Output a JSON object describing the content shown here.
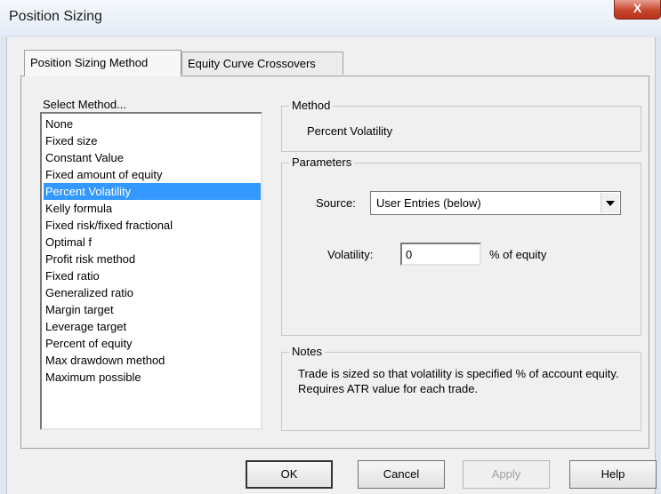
{
  "window": {
    "title": "Position Sizing",
    "close_label": "X"
  },
  "tabs": [
    {
      "label": "Position Sizing Method",
      "active": true
    },
    {
      "label": "Equity Curve Crossovers",
      "active": false
    }
  ],
  "method_list": {
    "label": "Select Method...",
    "items": [
      "None",
      "Fixed size",
      "Constant Value",
      "Fixed amount of equity",
      "Percent Volatility",
      "Kelly formula",
      "Fixed risk/fixed fractional",
      "Optimal f",
      "Profit risk method",
      "Fixed ratio",
      "Generalized ratio",
      "Margin target",
      "Leverage target",
      "Percent of equity",
      "Max drawdown method",
      "Maximum possible"
    ],
    "selected": "Percent Volatility"
  },
  "method_group": {
    "title": "Method",
    "value": "Percent Volatility"
  },
  "parameters": {
    "title": "Parameters",
    "source_label": "Source:",
    "source_value": "User Entries (below)",
    "volatility_label": "Volatility:",
    "volatility_value": "0",
    "volatility_unit": "% of equity"
  },
  "notes": {
    "title": "Notes",
    "text": "Trade is sized so that volatility is specified % of account equity. Requires ATR value for each trade."
  },
  "buttons": {
    "ok": "OK",
    "cancel": "Cancel",
    "apply": "Apply",
    "help": "Help"
  },
  "colors": {
    "selection": "#3399ff",
    "close_button": "#c8452c"
  }
}
